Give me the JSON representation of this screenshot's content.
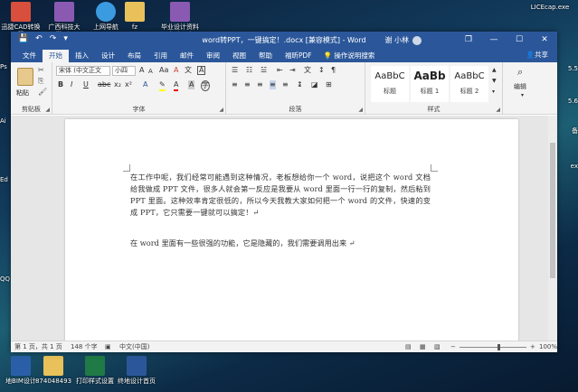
{
  "desktop": {
    "top_icons": [
      {
        "label": "迅捷CAD转换器"
      },
      {
        "label": "广西科技大学.zip"
      },
      {
        "label": "上网导航"
      },
      {
        "label": "fz"
      },
      {
        "label": "毕业设计资料（一）.zip"
      }
    ],
    "top_right_label": "LICEcap.exe",
    "bottom_icons": [
      {
        "label": "地BIM设计"
      },
      {
        "label": "874048493"
      },
      {
        "label": "打印样式设置"
      },
      {
        "label": "终地设计首页"
      }
    ],
    "left_edge_labels": [
      "Ps",
      "Ai",
      "Ed",
      "QQ"
    ],
    "right_edge_labels": [
      "5.5",
      "5.6",
      "备",
      "ex"
    ]
  },
  "window": {
    "title": "word转PPT，一键搞定！.docx [兼容模式] - Word",
    "user": "谢 小林",
    "controls": {
      "minimize": "—",
      "restore": "❐",
      "maximize": "☐",
      "close": "✕"
    },
    "tabs": [
      "文件",
      "开始",
      "插入",
      "设计",
      "布局",
      "引用",
      "邮件",
      "审阅",
      "视图",
      "帮助",
      "福昕PDF"
    ],
    "active_tab": "开始",
    "tell_me": "操作说明搜索",
    "share": "共享"
  },
  "ribbon": {
    "clipboard": {
      "label": "剪贴板",
      "paste": "粘贴"
    },
    "font": {
      "label": "字体",
      "font_name": "宋体 (中文正文",
      "font_size": "小四",
      "bold": "B",
      "italic": "I",
      "underline": "U",
      "grow": "A",
      "shrink": "A",
      "clear": "A",
      "phonetic": "文",
      "border": "A"
    },
    "paragraph": {
      "label": "段落"
    },
    "styles": {
      "label": "样式",
      "items": [
        {
          "sample": "AaBbC",
          "name": "标题"
        },
        {
          "sample": "AaBb",
          "name": "标题 1"
        },
        {
          "sample": "AaBbC",
          "name": "标题 2"
        }
      ]
    },
    "editing": {
      "label": "编辑"
    }
  },
  "document": {
    "paragraph1": "在工作中呢，我们经常可能遇到这种情况，老板想给你一个 word，说把这个 word 文档给我做成 PPT 文件，很多人就会第一反应是我要从 word 里面一行一行的复制，然后粘到 PPT 里面。这种效率肯定很低的，所以今天我教大家如何把一个 word 的文件，快速的变成 PPT，它只需要一键就可以搞定！↵",
    "paragraph2": "在 word 里面有一些很强的功能，它是隐藏的，我们需要调用出来  ↵"
  },
  "statusbar": {
    "page": "第 1 页，共 1 页",
    "words": "148 个字",
    "language": "中文(中国)",
    "zoom": "100%"
  },
  "colors": {
    "accent": "#2b579a",
    "ribbon_bg": "#f3f3f3"
  }
}
